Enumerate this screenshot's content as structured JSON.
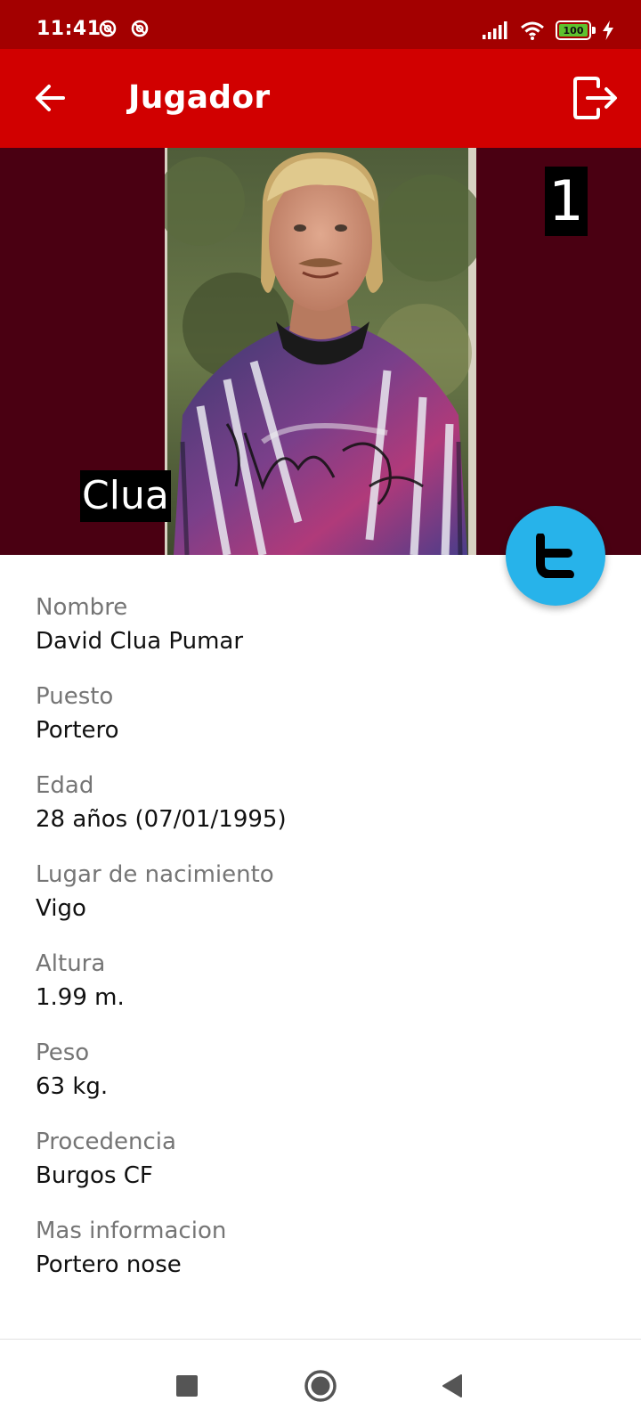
{
  "status_bar": {
    "time": "11:41",
    "notification_icons": [
      "no-disturb-icon",
      "no-disturb-icon"
    ],
    "battery_level": "100",
    "battery_color": "#5ec22e",
    "icons": [
      "signal-icon",
      "wifi-icon",
      "battery-icon",
      "charging-icon"
    ]
  },
  "app_bar": {
    "title": "Jugador",
    "back_icon": "arrow-left-icon",
    "logout_icon": "logout-icon",
    "color": "#d10000"
  },
  "player": {
    "number": "1",
    "short_name": "Clua",
    "photo": "player-photo"
  },
  "fab": {
    "icon": "twitter-t-icon",
    "color": "#27b3ea"
  },
  "fields": [
    {
      "label": "Nombre",
      "value": "David Clua Pumar"
    },
    {
      "label": "Puesto",
      "value": "Portero"
    },
    {
      "label": "Edad",
      "value": "28 años (07/01/1995)"
    },
    {
      "label": "Lugar de nacimiento",
      "value": "Vigo"
    },
    {
      "label": "Altura",
      "value": "1.99 m."
    },
    {
      "label": "Peso",
      "value": "63 kg."
    },
    {
      "label": "Procedencia",
      "value": "Burgos CF"
    },
    {
      "label": "Mas informacion",
      "value": "Portero nose"
    }
  ],
  "nav_bar": {
    "icons": [
      "recents-square-icon",
      "home-circle-icon",
      "back-triangle-icon"
    ]
  }
}
